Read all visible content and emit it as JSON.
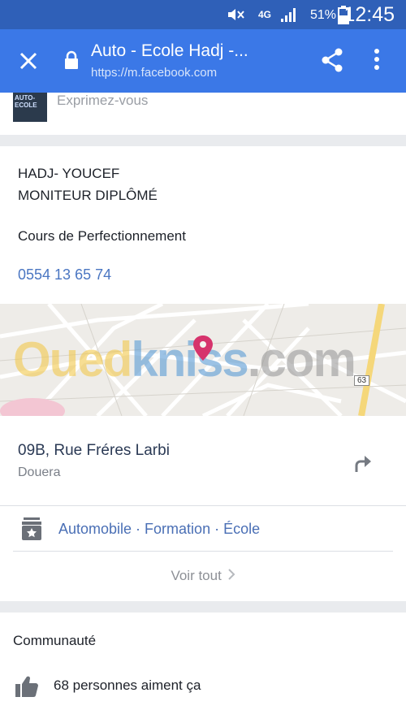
{
  "status_bar": {
    "network": "4G",
    "battery": "51%",
    "time": "12:45",
    "icons": [
      "mute-icon",
      "signal-icon",
      "battery-icon"
    ]
  },
  "toolbar": {
    "title": "Auto - Ecole Hadj -...",
    "url": "https://m.facebook.com",
    "icons": [
      "close-icon",
      "lock-icon",
      "share-icon",
      "more-icon"
    ],
    "background": "#3b78e7"
  },
  "composer": {
    "thumbnail_text": "AUTO-ECOLE",
    "placeholder": "Exprimez-vous"
  },
  "info": {
    "name_line1": "HADJ- YOUCEF",
    "name_line2": "MONITEUR DIPLÔMÉ",
    "description": "Cours de Perfectionnement",
    "phone": "0554 13 65 74"
  },
  "map": {
    "watermark_part1": "Oued",
    "watermark_part2": "kniss",
    "watermark_part3": ".com",
    "road_number": "63"
  },
  "location": {
    "address": "09B, Rue Fréres Larbi",
    "city": "Douera"
  },
  "categories": {
    "text": "Automobile · Formation · École"
  },
  "see_all": {
    "label": "Voir tout"
  },
  "community": {
    "heading": "Communauté",
    "likes": "68 personnes aiment ça"
  },
  "colors": {
    "accent": "#3b78e7",
    "status_bar": "#2f60b8",
    "link": "#4a76c2",
    "pin": "#d6336c"
  }
}
